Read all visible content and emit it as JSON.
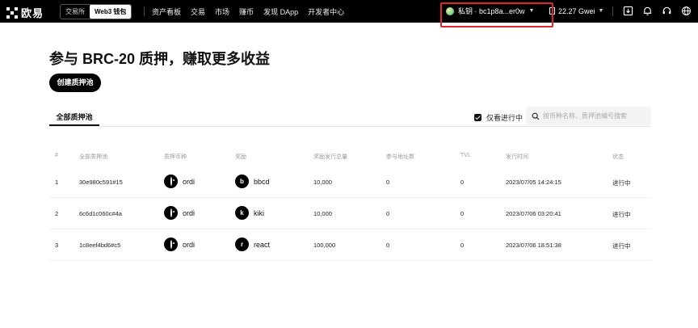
{
  "topbar": {
    "logo_text": "欧易",
    "mode_tabs": {
      "exchange": "交易所",
      "web3": "Web3 钱包"
    },
    "nav": [
      "资产看板",
      "交易",
      "市场",
      "赚币",
      "发现 DApp",
      "开发者中心"
    ],
    "wallet": {
      "label": "私钥 · bc1p8a...er0w"
    },
    "gas": {
      "label": "22.27 Gwei"
    },
    "icons": [
      "download-icon",
      "bell-icon",
      "headset-icon",
      "globe-icon"
    ]
  },
  "page": {
    "title": "参与 BRC-20 质押，赚取更多收益",
    "create_button": "创建质押池"
  },
  "tabs": {
    "all_pools": "全部质押池"
  },
  "filters": {
    "only_active_label": "仅看进行中",
    "only_active_checked": true,
    "search_placeholder": "按币种名称、质押池编号搜索"
  },
  "table": {
    "headers": {
      "index": "#",
      "pool": "全部质押池",
      "stake_coin": "质押币种",
      "reward": "奖励",
      "reward_total": "奖励发行总量",
      "participants": "参与地址数",
      "tvl": "TVL",
      "release_time": "发行时间",
      "status": "状态"
    },
    "rows": [
      {
        "index": "1",
        "pool": "30e980c591#15",
        "stake_coin": "ordi",
        "reward": "bbcd",
        "reward_letter": "b",
        "reward_total": "10,000",
        "participants": "0",
        "tvl": "0",
        "release_time": "2023/07/05 14:24:15",
        "status": "进行中"
      },
      {
        "index": "2",
        "pool": "6c6d1c060c#4a",
        "stake_coin": "ordi",
        "reward": "kiki",
        "reward_letter": "k",
        "reward_total": "10,000",
        "participants": "0",
        "tvl": "0",
        "release_time": "2023/07/06 03:20:41",
        "status": "进行中"
      },
      {
        "index": "3",
        "pool": "1c8eef4bd6#c5",
        "stake_coin": "ordi",
        "reward": "react",
        "reward_letter": "r",
        "reward_total": "100,000",
        "participants": "0",
        "tvl": "0",
        "release_time": "2023/07/06 18:51:38",
        "status": "进行中"
      }
    ]
  },
  "colors": {
    "highlight_border": "#e0252b",
    "topbar_bg": "#000000",
    "accent_dark": "#111111"
  }
}
